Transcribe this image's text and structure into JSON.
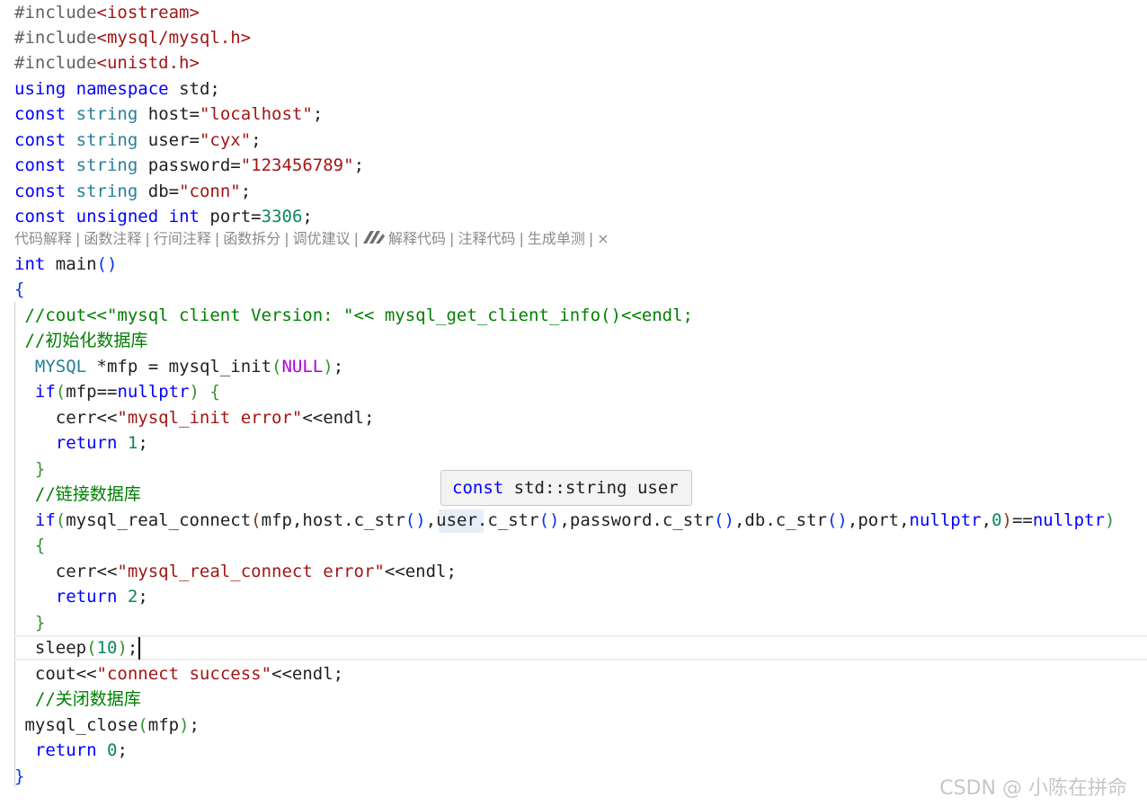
{
  "codegeex_bar": {
    "actions": [
      "代码解释",
      "函数注释",
      "行间注释",
      "函数拆分",
      "调优建议",
      "解释代码",
      "注释代码",
      "生成单测"
    ],
    "close_symbol": "×",
    "separator": "|",
    "logo_icon": "codegeex-logo-icon"
  },
  "tooltip": {
    "keyword": "const",
    "type": "std::string",
    "name": "user"
  },
  "watermark": {
    "text": "CSDN @ 小陈在拼命"
  },
  "code": {
    "include_directive": "#include",
    "include_1": "<iostream>",
    "include_2": "<mysql/mysql.h>",
    "include_3": "<unistd.h>",
    "kw_using": "using",
    "kw_namespace": "namespace",
    "ns_std": "std",
    "kw_const": "const",
    "kw_string": "string",
    "kw_unsigned": "unsigned",
    "kw_int": "int",
    "kw_if": "if",
    "kw_return": "return",
    "var_host": "host",
    "var_user": "user",
    "var_password": "password",
    "var_db": "db",
    "var_port": "port",
    "str_host": "\"localhost\"",
    "str_user": "\"cyx\"",
    "str_password": "\"123456789\"",
    "str_db": "\"conn\"",
    "num_port": "3306",
    "fn_main": "main",
    "comment_version": "//cout<<\"mysql client Version: \"<< mysql_get_client_info()<<endl;",
    "comment_init": "//初始化数据库",
    "type_mysql": "MYSQL",
    "var_mfp_ptr": "*mfp",
    "fn_mysql_init": "mysql_init",
    "macro_null": "NULL",
    "var_mfp": "mfp",
    "kw_nullptr": "nullptr",
    "var_cerr": "cerr",
    "str_init_error": "\"mysql_init error\"",
    "var_endl": "endl",
    "num_1": "1",
    "comment_connect": "//链接数据库",
    "fn_real_connect": "mysql_real_connect",
    "fn_c_str": "c_str",
    "num_0": "0",
    "str_connect_error": "\"mysql_real_connect error\"",
    "num_2": "2",
    "fn_sleep": "sleep",
    "num_10": "10",
    "var_cout": "cout",
    "str_success": "\"connect success\"",
    "comment_close": "//关闭数据库",
    "fn_close": "mysql_close"
  }
}
